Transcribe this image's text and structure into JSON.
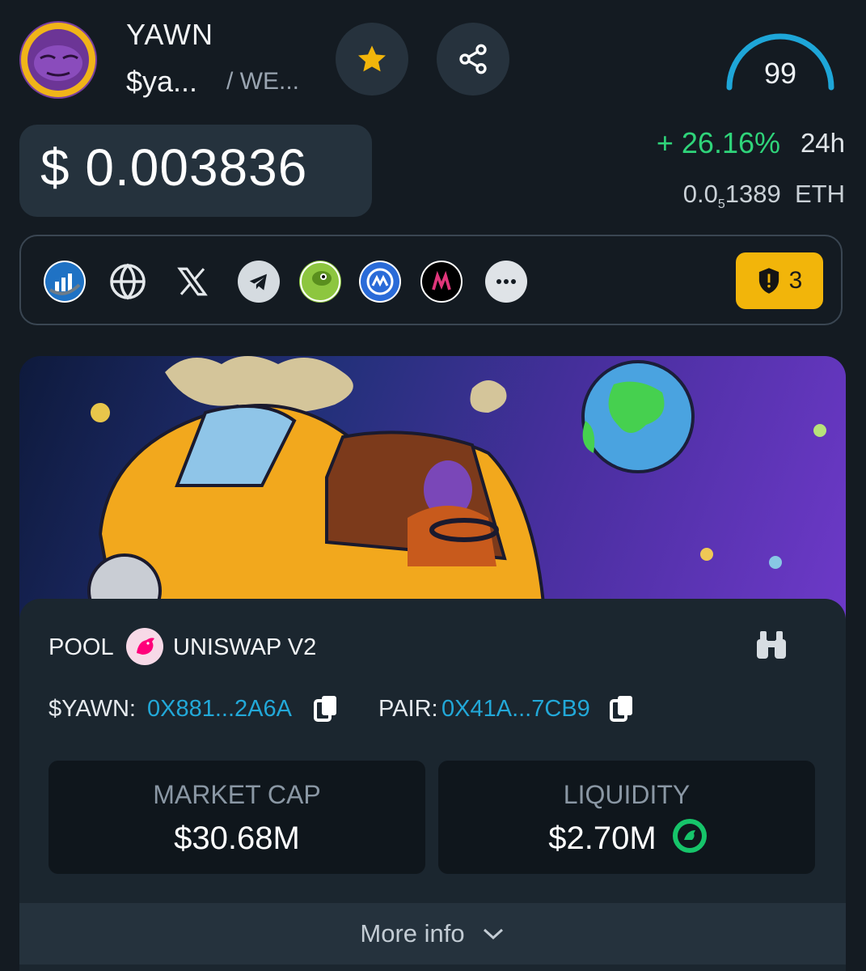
{
  "token": {
    "name": "YAWN",
    "symbol": "$ya...",
    "chain": "/ WE...",
    "score": "99"
  },
  "price": {
    "usd": "$ 0.003836",
    "change": "+ 26.16%",
    "change_period": "24h",
    "eth_prefix": "0.0",
    "eth_sub": "5",
    "eth_digits": "1389",
    "eth_unit": "ETH"
  },
  "links": [
    {
      "icon": "dextools-icon"
    },
    {
      "icon": "globe-icon"
    },
    {
      "icon": "x-icon"
    },
    {
      "icon": "telegram-icon"
    },
    {
      "icon": "coingecko-icon"
    },
    {
      "icon": "coinmarketcap-icon"
    },
    {
      "icon": "dexscreener-icon"
    },
    {
      "icon": "more-icon"
    }
  ],
  "audit": {
    "count": "3"
  },
  "pool": {
    "label": "POOL",
    "dex": "UNISWAP V2",
    "token_label": "$YAWN:",
    "token_address": "0X881...2A6A",
    "pair_label": "PAIR:",
    "pair_address": "0X41A...7CB9"
  },
  "stats": {
    "market_cap_label": "MARKET CAP",
    "market_cap": "$30.68M",
    "liquidity_label": "LIQUIDITY",
    "liquidity": "$2.70M"
  },
  "more_info": "More info",
  "colors": {
    "background": "#141b22",
    "accent_green": "#2fd47a",
    "address_blue": "#22a8d8",
    "audit_yellow": "#f2b50a",
    "gauge_blue": "#1ea6d8"
  }
}
